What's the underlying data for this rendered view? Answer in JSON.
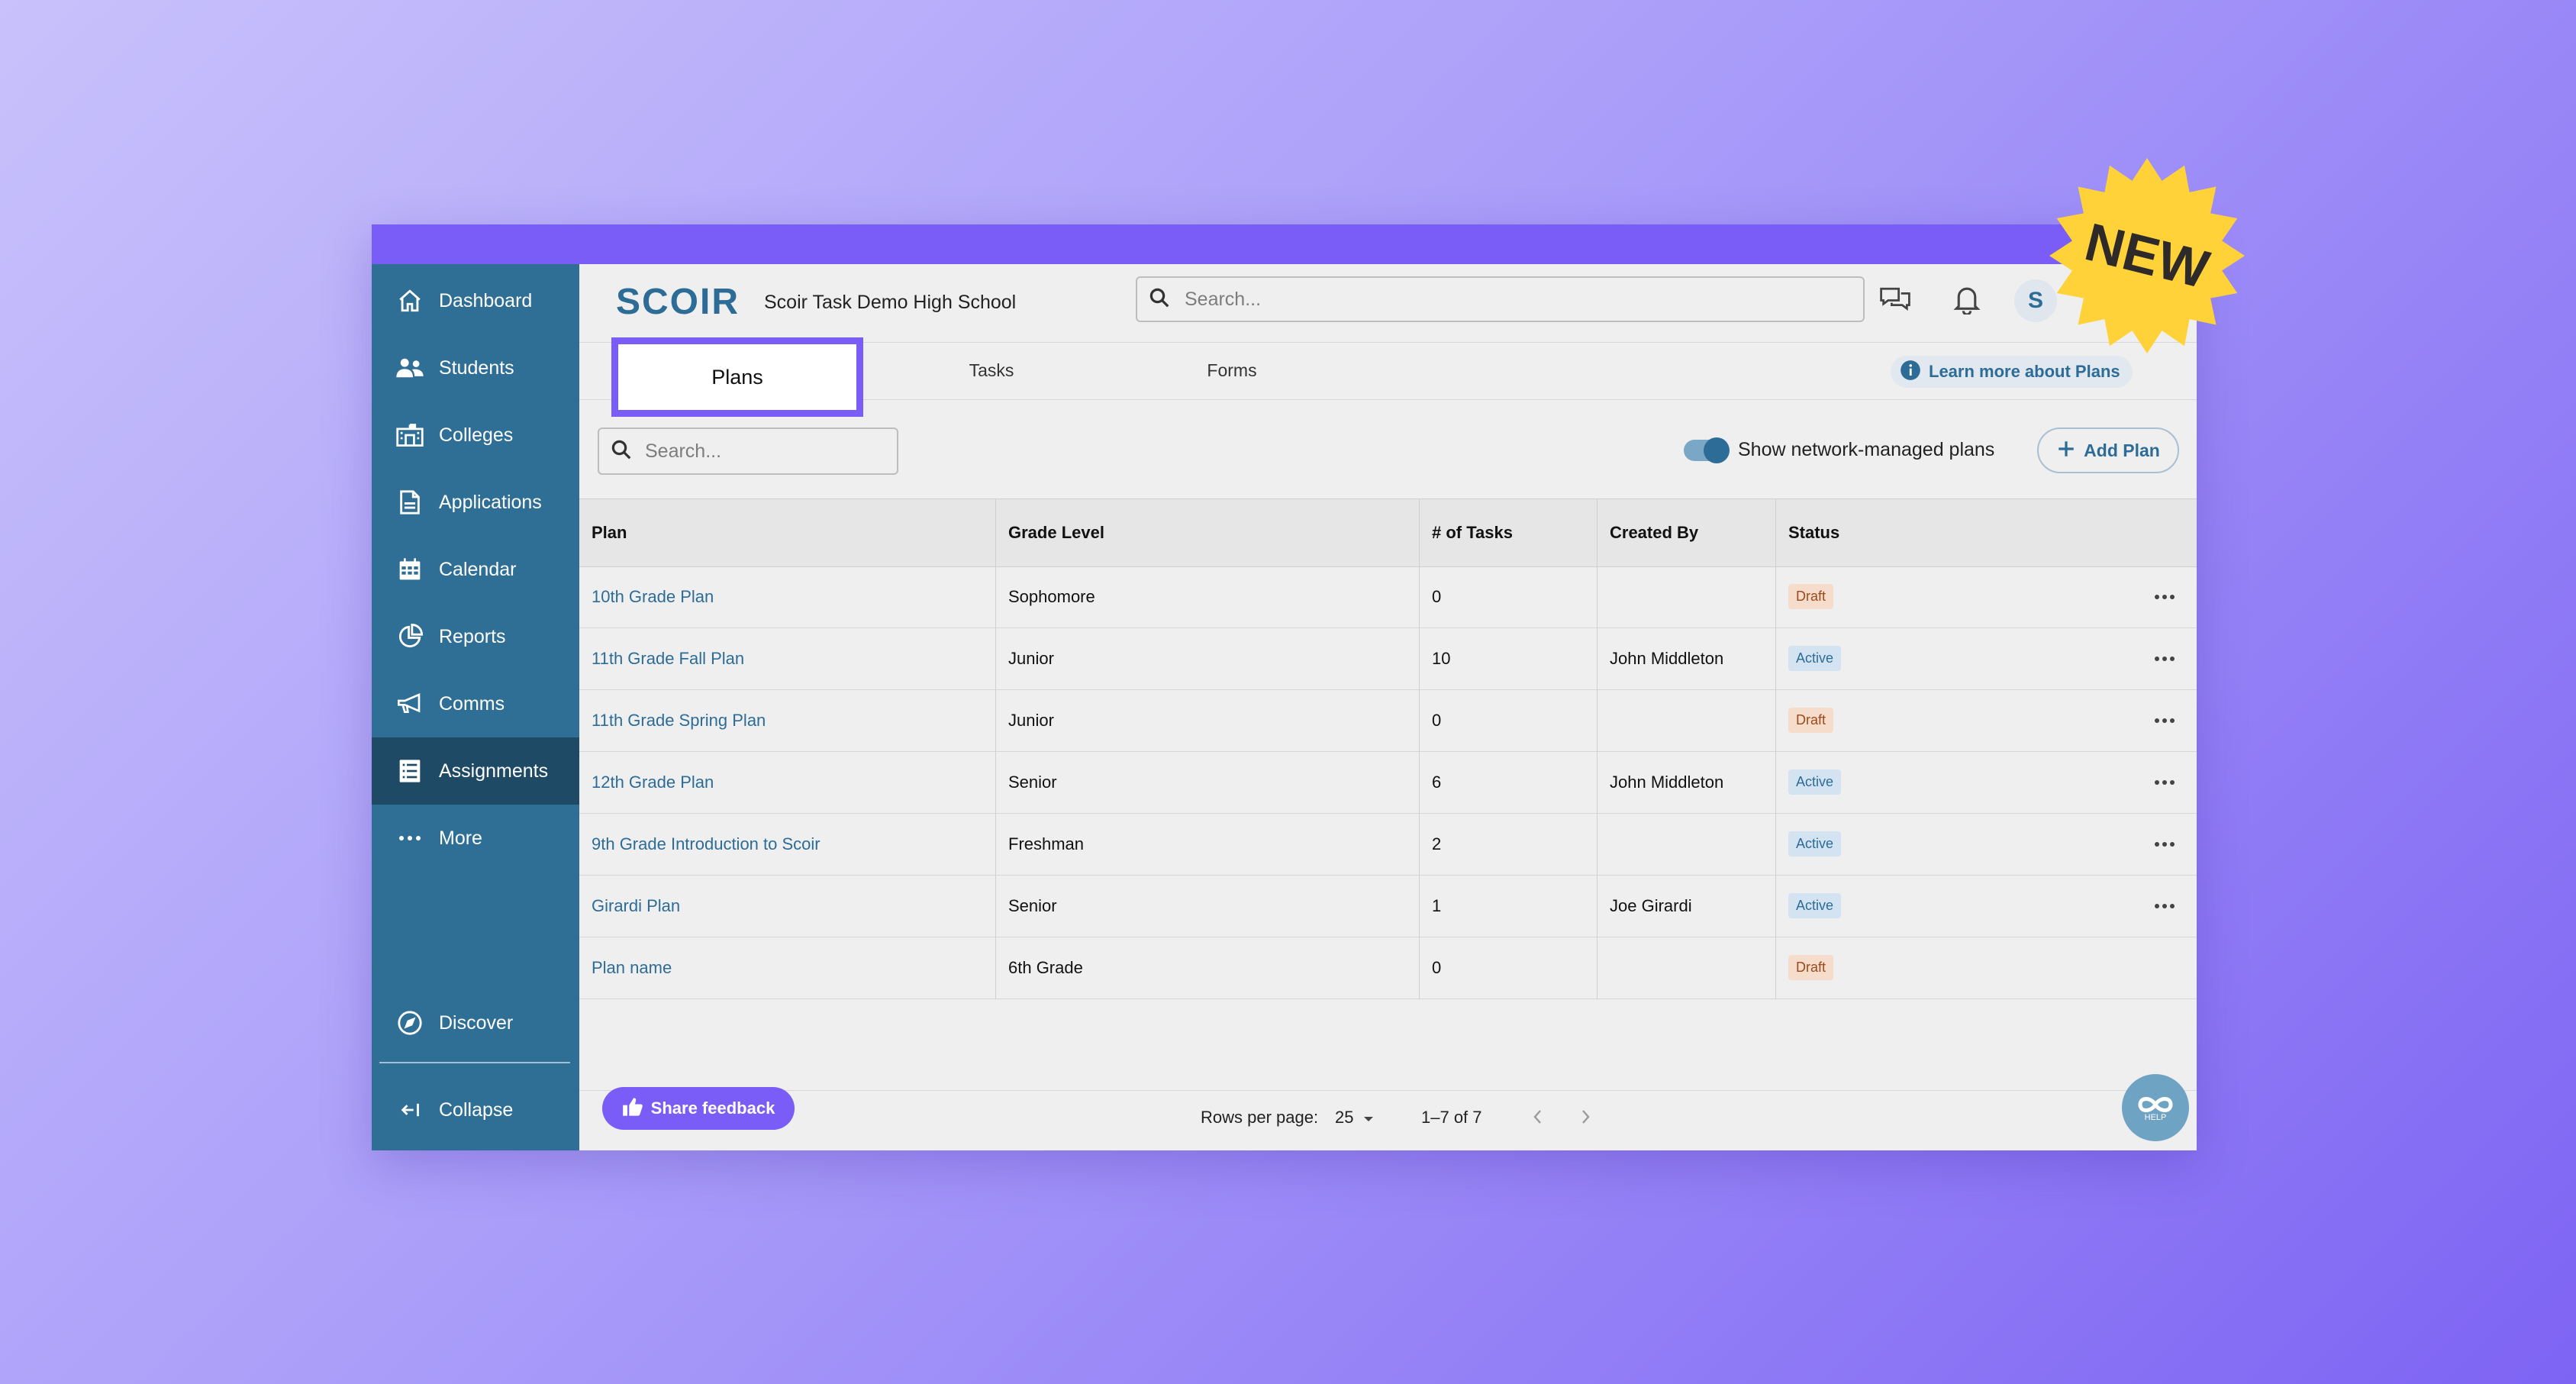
{
  "sidebar": {
    "items": [
      {
        "label": "Dashboard",
        "icon": "home-icon"
      },
      {
        "label": "Students",
        "icon": "students-icon"
      },
      {
        "label": "Colleges",
        "icon": "college-icon"
      },
      {
        "label": "Applications",
        "icon": "document-icon"
      },
      {
        "label": "Calendar",
        "icon": "calendar-icon"
      },
      {
        "label": "Reports",
        "icon": "pie-chart-icon"
      },
      {
        "label": "Comms",
        "icon": "megaphone-icon"
      },
      {
        "label": "Assignments",
        "icon": "list-icon",
        "active": true
      },
      {
        "label": "More",
        "icon": "more-dots-icon"
      }
    ],
    "discover_label": "Discover",
    "collapse_label": "Collapse"
  },
  "header": {
    "logo": "SCOIR",
    "school_name": "Scoir Task Demo High School",
    "search_placeholder": "Search...",
    "avatar_initial": "S"
  },
  "tabs": [
    {
      "label": "Plans",
      "selected": true
    },
    {
      "label": "Tasks",
      "selected": false
    },
    {
      "label": "Forms",
      "selected": false
    }
  ],
  "learn_more_label": "Learn more about Plans",
  "toolbar": {
    "search_placeholder": "Search...",
    "toggle_label": "Show network-managed plans",
    "toggle_on": true,
    "add_plan_label": "Add Plan"
  },
  "table": {
    "columns": [
      "Plan",
      "Grade Level",
      "# of Tasks",
      "Created By",
      "Status"
    ],
    "rows": [
      {
        "plan": "10th Grade Plan",
        "grade": "Sophomore",
        "tasks": "0",
        "created_by": "",
        "status": "Draft",
        "has_menu": true
      },
      {
        "plan": "11th Grade Fall Plan",
        "grade": "Junior",
        "tasks": "10",
        "created_by": "John Middleton",
        "status": "Active",
        "has_menu": true
      },
      {
        "plan": "11th Grade Spring Plan",
        "grade": "Junior",
        "tasks": "0",
        "created_by": "",
        "status": "Draft",
        "has_menu": true
      },
      {
        "plan": "12th Grade Plan",
        "grade": "Senior",
        "tasks": "6",
        "created_by": "John Middleton",
        "status": "Active",
        "has_menu": true
      },
      {
        "plan": "9th Grade Introduction to Scoir",
        "grade": "Freshman",
        "tasks": "2",
        "created_by": "",
        "status": "Active",
        "has_menu": true
      },
      {
        "plan": "Girardi Plan",
        "grade": "Senior",
        "tasks": "1",
        "created_by": "Joe Girardi",
        "status": "Active",
        "has_menu": true
      },
      {
        "plan": "Plan name",
        "grade": "6th Grade",
        "tasks": "0",
        "created_by": "",
        "status": "Draft",
        "has_menu": false
      }
    ]
  },
  "footer": {
    "share_feedback_label": "Share feedback",
    "rows_per_page_label": "Rows per page:",
    "rows_per_page_value": "25",
    "range_label": "1–7 of 7"
  },
  "help_label": "HELP",
  "new_badge_label": "NEW",
  "colors": {
    "sidebar": "#2f6f95",
    "sidebar_active": "#1e4a66",
    "accent_purple": "#7a5cf7",
    "link_blue": "#2c6c97",
    "badge_yellow": "#ffd23a"
  }
}
